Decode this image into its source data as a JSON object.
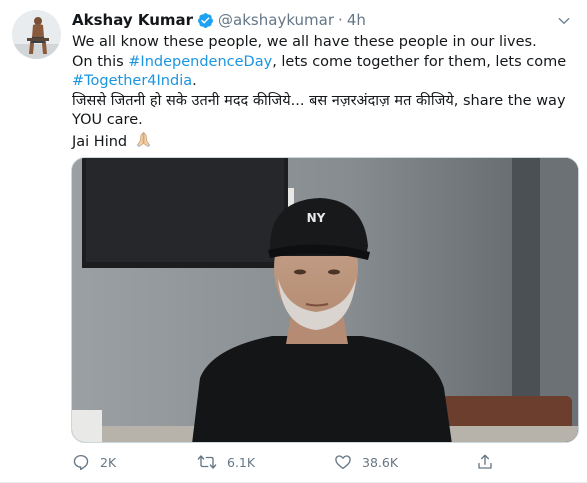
{
  "tweet": {
    "author_name": "Akshay Kumar",
    "handle": "@akshaykumar",
    "separator": "·",
    "time": "4h",
    "line1": "We all know these people, we all have these people in our lives.",
    "line2_prefix": "On this ",
    "hashtag1": "#IndependenceDay",
    "line2_suffix": ", lets come together for them, lets come",
    "hashtag2": "#Together4India",
    "line3_suffix": ".",
    "line4": "जिससे जितनी हो सके उतनी मदद कीजिये... बस नज़रअंदाज़ मत कीजिये, share the way",
    "line5": "YOU care.",
    "line6": "Jai Hind"
  },
  "actions": {
    "reply_count": "2K",
    "retweet_count": "6.1K",
    "like_count": "38.6K"
  },
  "colors": {
    "link": "#1b95e0",
    "muted": "#657786",
    "verified": "#1da1f2"
  }
}
